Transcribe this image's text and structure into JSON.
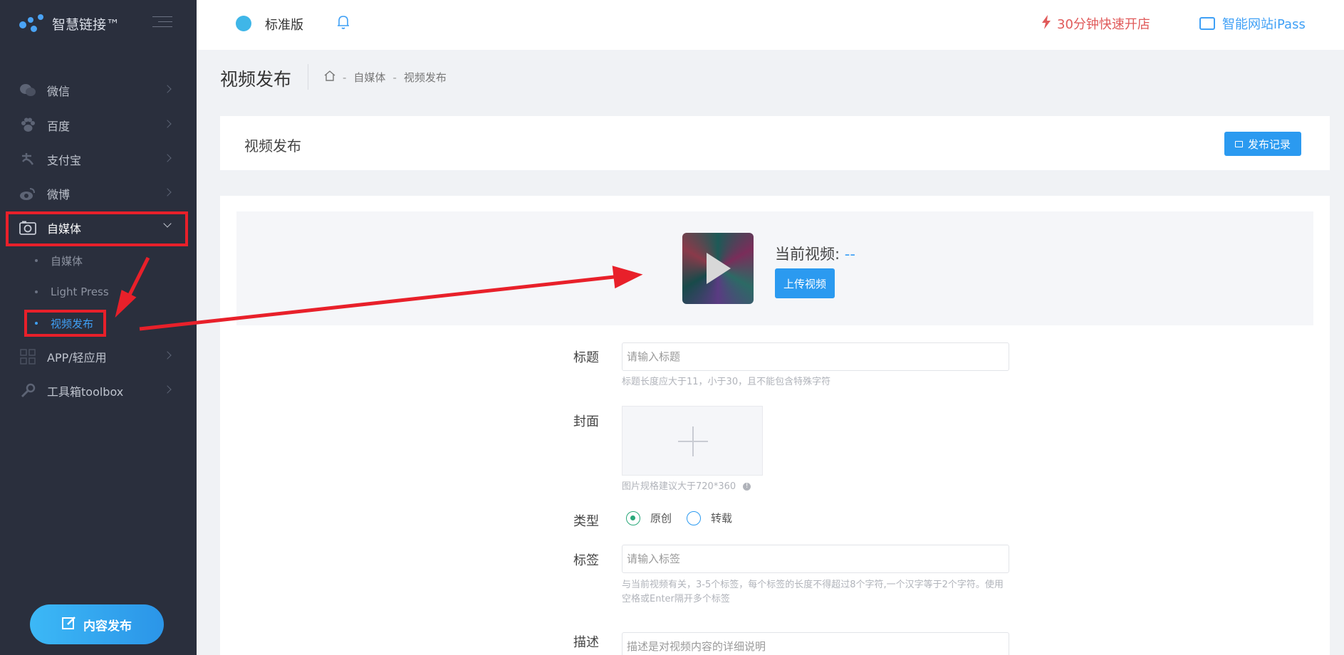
{
  "brand": {
    "name": "智慧链接™"
  },
  "sidebar": {
    "items": [
      {
        "label": "微信",
        "icon": "wechat-icon"
      },
      {
        "label": "百度",
        "icon": "paw-icon"
      },
      {
        "label": "支付宝",
        "icon": "alipay-icon"
      },
      {
        "label": "微博",
        "icon": "weibo-icon"
      },
      {
        "label": "自媒体",
        "icon": "camera-icon"
      }
    ],
    "sub_items": [
      {
        "label": "自媒体"
      },
      {
        "label": "Light Press"
      },
      {
        "label": "视频发布"
      }
    ],
    "more_items": [
      {
        "label": "APP/轻应用",
        "icon": "apps-icon"
      },
      {
        "label": "工具箱toolbox",
        "icon": "wrench-icon"
      }
    ],
    "publish_button": "内容发布"
  },
  "topbar": {
    "edition": "标准版",
    "quick_open": "30分钟快速开店",
    "ipass": "智能网站iPass"
  },
  "page": {
    "title": "视频发布",
    "breadcrumb": [
      "自媒体",
      "视频发布"
    ]
  },
  "card": {
    "title": "视频发布",
    "record_button": "发布记录"
  },
  "video": {
    "current_label": "当前视频:",
    "current_value": "--",
    "upload_button": "上传视频"
  },
  "form": {
    "title_label": "标题",
    "title_placeholder": "请输入标题",
    "title_hint": "标题长度应大于11，小于30，且不能包含特殊字符",
    "cover_label": "封面",
    "cover_hint": "图片规格建议大于720*360",
    "type_label": "类型",
    "type_options": [
      "原创",
      "转载"
    ],
    "tag_label": "标签",
    "tag_placeholder": "请输入标签",
    "tag_hint_1": "与当前视频有关，3-5个标签，每个标签的长度不得超过8个字符,一个汉字等于2个字符。使用",
    "tag_hint_2": "空格或Enter隔开多个标签",
    "desc_label": "描述",
    "desc_placeholder": "描述是对视频内容的详细说明"
  },
  "colors": {
    "sidebar_bg": "#2a2f3d",
    "accent": "#2b9af0",
    "annotation": "#e8202a"
  }
}
